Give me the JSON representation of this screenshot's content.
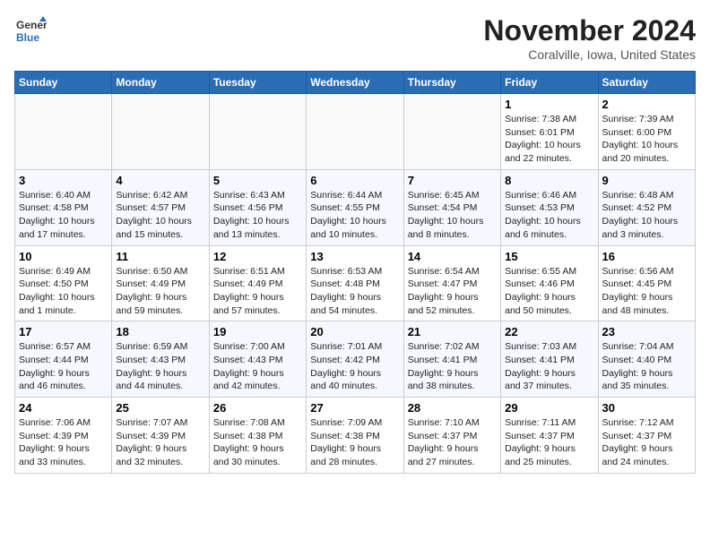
{
  "header": {
    "logo_line1": "General",
    "logo_line2": "Blue",
    "month": "November 2024",
    "location": "Coralville, Iowa, United States"
  },
  "weekdays": [
    "Sunday",
    "Monday",
    "Tuesday",
    "Wednesday",
    "Thursday",
    "Friday",
    "Saturday"
  ],
  "weeks": [
    [
      {
        "day": "",
        "info": ""
      },
      {
        "day": "",
        "info": ""
      },
      {
        "day": "",
        "info": ""
      },
      {
        "day": "",
        "info": ""
      },
      {
        "day": "",
        "info": ""
      },
      {
        "day": "1",
        "info": "Sunrise: 7:38 AM\nSunset: 6:01 PM\nDaylight: 10 hours\nand 22 minutes."
      },
      {
        "day": "2",
        "info": "Sunrise: 7:39 AM\nSunset: 6:00 PM\nDaylight: 10 hours\nand 20 minutes."
      }
    ],
    [
      {
        "day": "3",
        "info": "Sunrise: 6:40 AM\nSunset: 4:58 PM\nDaylight: 10 hours\nand 17 minutes."
      },
      {
        "day": "4",
        "info": "Sunrise: 6:42 AM\nSunset: 4:57 PM\nDaylight: 10 hours\nand 15 minutes."
      },
      {
        "day": "5",
        "info": "Sunrise: 6:43 AM\nSunset: 4:56 PM\nDaylight: 10 hours\nand 13 minutes."
      },
      {
        "day": "6",
        "info": "Sunrise: 6:44 AM\nSunset: 4:55 PM\nDaylight: 10 hours\nand 10 minutes."
      },
      {
        "day": "7",
        "info": "Sunrise: 6:45 AM\nSunset: 4:54 PM\nDaylight: 10 hours\nand 8 minutes."
      },
      {
        "day": "8",
        "info": "Sunrise: 6:46 AM\nSunset: 4:53 PM\nDaylight: 10 hours\nand 6 minutes."
      },
      {
        "day": "9",
        "info": "Sunrise: 6:48 AM\nSunset: 4:52 PM\nDaylight: 10 hours\nand 3 minutes."
      }
    ],
    [
      {
        "day": "10",
        "info": "Sunrise: 6:49 AM\nSunset: 4:50 PM\nDaylight: 10 hours\nand 1 minute."
      },
      {
        "day": "11",
        "info": "Sunrise: 6:50 AM\nSunset: 4:49 PM\nDaylight: 9 hours\nand 59 minutes."
      },
      {
        "day": "12",
        "info": "Sunrise: 6:51 AM\nSunset: 4:49 PM\nDaylight: 9 hours\nand 57 minutes."
      },
      {
        "day": "13",
        "info": "Sunrise: 6:53 AM\nSunset: 4:48 PM\nDaylight: 9 hours\nand 54 minutes."
      },
      {
        "day": "14",
        "info": "Sunrise: 6:54 AM\nSunset: 4:47 PM\nDaylight: 9 hours\nand 52 minutes."
      },
      {
        "day": "15",
        "info": "Sunrise: 6:55 AM\nSunset: 4:46 PM\nDaylight: 9 hours\nand 50 minutes."
      },
      {
        "day": "16",
        "info": "Sunrise: 6:56 AM\nSunset: 4:45 PM\nDaylight: 9 hours\nand 48 minutes."
      }
    ],
    [
      {
        "day": "17",
        "info": "Sunrise: 6:57 AM\nSunset: 4:44 PM\nDaylight: 9 hours\nand 46 minutes."
      },
      {
        "day": "18",
        "info": "Sunrise: 6:59 AM\nSunset: 4:43 PM\nDaylight: 9 hours\nand 44 minutes."
      },
      {
        "day": "19",
        "info": "Sunrise: 7:00 AM\nSunset: 4:43 PM\nDaylight: 9 hours\nand 42 minutes."
      },
      {
        "day": "20",
        "info": "Sunrise: 7:01 AM\nSunset: 4:42 PM\nDaylight: 9 hours\nand 40 minutes."
      },
      {
        "day": "21",
        "info": "Sunrise: 7:02 AM\nSunset: 4:41 PM\nDaylight: 9 hours\nand 38 minutes."
      },
      {
        "day": "22",
        "info": "Sunrise: 7:03 AM\nSunset: 4:41 PM\nDaylight: 9 hours\nand 37 minutes."
      },
      {
        "day": "23",
        "info": "Sunrise: 7:04 AM\nSunset: 4:40 PM\nDaylight: 9 hours\nand 35 minutes."
      }
    ],
    [
      {
        "day": "24",
        "info": "Sunrise: 7:06 AM\nSunset: 4:39 PM\nDaylight: 9 hours\nand 33 minutes."
      },
      {
        "day": "25",
        "info": "Sunrise: 7:07 AM\nSunset: 4:39 PM\nDaylight: 9 hours\nand 32 minutes."
      },
      {
        "day": "26",
        "info": "Sunrise: 7:08 AM\nSunset: 4:38 PM\nDaylight: 9 hours\nand 30 minutes."
      },
      {
        "day": "27",
        "info": "Sunrise: 7:09 AM\nSunset: 4:38 PM\nDaylight: 9 hours\nand 28 minutes."
      },
      {
        "day": "28",
        "info": "Sunrise: 7:10 AM\nSunset: 4:37 PM\nDaylight: 9 hours\nand 27 minutes."
      },
      {
        "day": "29",
        "info": "Sunrise: 7:11 AM\nSunset: 4:37 PM\nDaylight: 9 hours\nand 25 minutes."
      },
      {
        "day": "30",
        "info": "Sunrise: 7:12 AM\nSunset: 4:37 PM\nDaylight: 9 hours\nand 24 minutes."
      }
    ]
  ]
}
